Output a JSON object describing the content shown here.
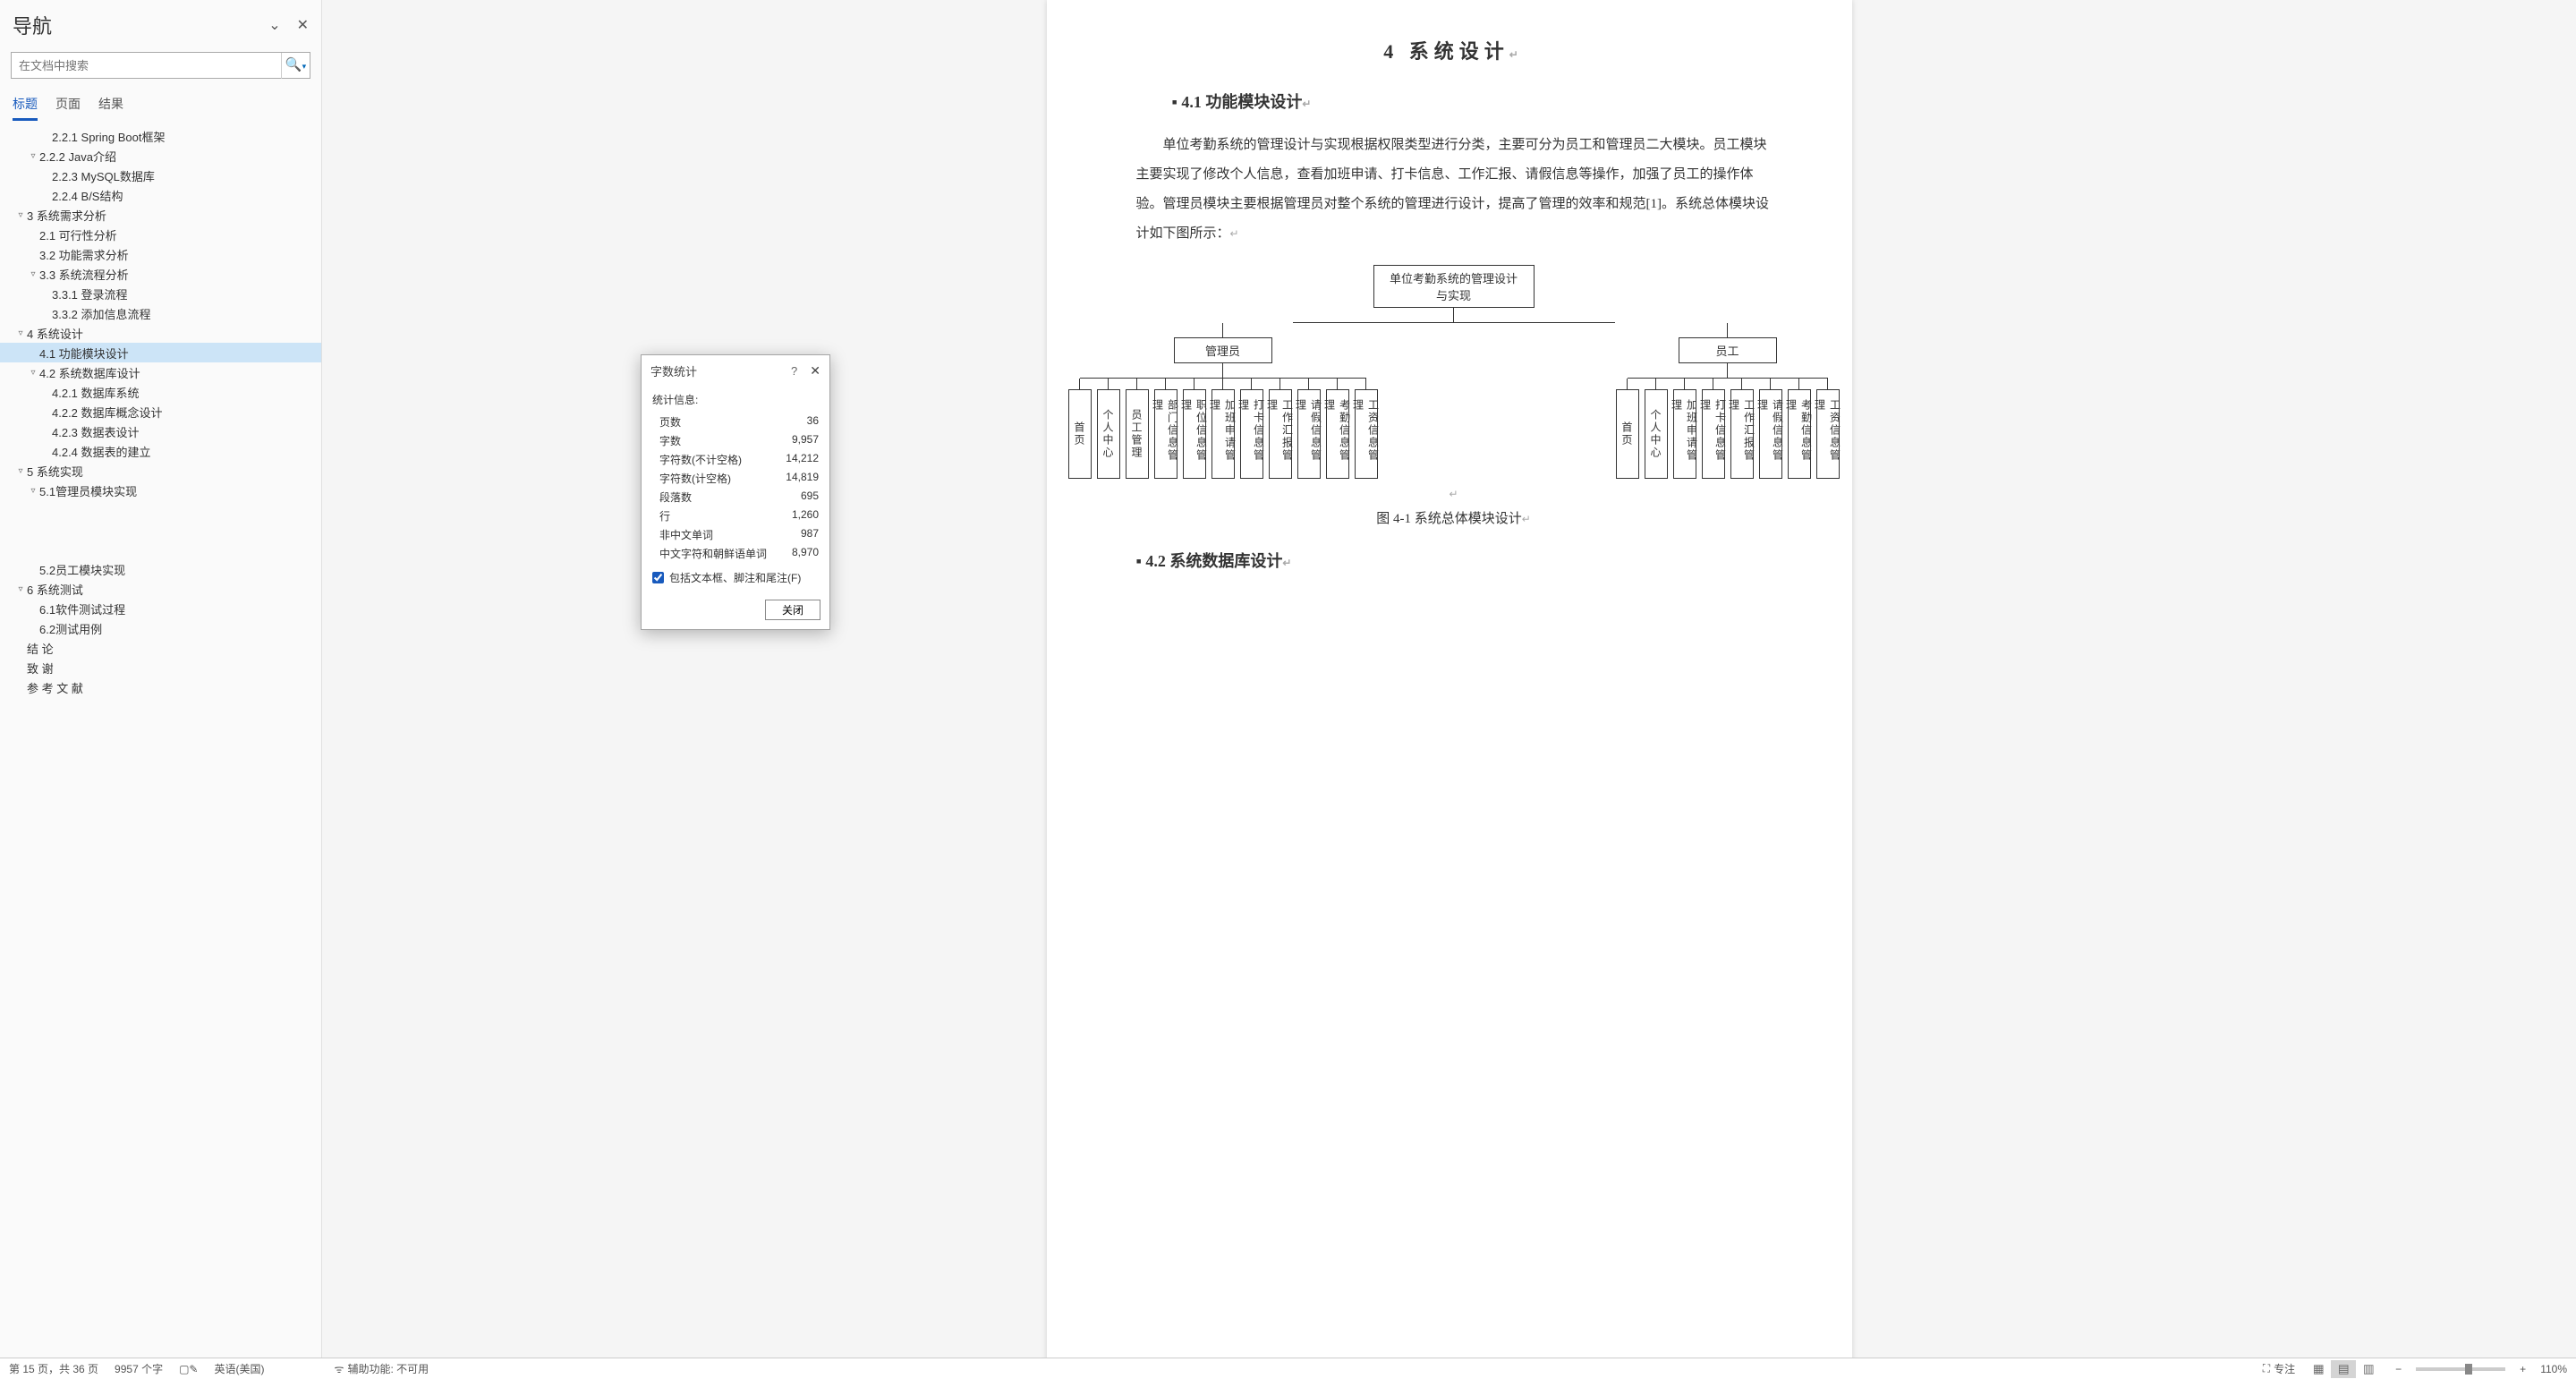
{
  "nav": {
    "title": "导航",
    "search_placeholder": "在文档中搜索",
    "tabs": [
      "标题",
      "页面",
      "结果"
    ],
    "active_tab": 0,
    "tree": [
      {
        "label": "2.2.1 Spring Boot框架",
        "level": 3,
        "expand": ""
      },
      {
        "label": "2.2.2 Java介绍",
        "level": 2,
        "expand": "▿"
      },
      {
        "label": "2.2.3 MySQL数据库",
        "level": 3,
        "expand": ""
      },
      {
        "label": "2.2.4 B/S结构",
        "level": 3,
        "expand": ""
      },
      {
        "label": "3  系统需求分析",
        "level": 1,
        "expand": "▿"
      },
      {
        "label": "2.1 可行性分析",
        "level": 2,
        "expand": ""
      },
      {
        "label": "3.2 功能需求分析",
        "level": 2,
        "expand": ""
      },
      {
        "label": "3.3 系统流程分析",
        "level": 2,
        "expand": "▿"
      },
      {
        "label": "3.3.1 登录流程",
        "level": 3,
        "expand": ""
      },
      {
        "label": "3.3.2 添加信息流程",
        "level": 3,
        "expand": ""
      },
      {
        "label": "4  系统设计",
        "level": 1,
        "expand": "▿"
      },
      {
        "label": "4.1 功能模块设计",
        "level": 2,
        "expand": "",
        "selected": true
      },
      {
        "label": "4.2 系统数据库设计",
        "level": 2,
        "expand": "▿"
      },
      {
        "label": "4.2.1 数据库系统",
        "level": 3,
        "expand": ""
      },
      {
        "label": "4.2.2 数据库概念设计",
        "level": 3,
        "expand": ""
      },
      {
        "label": "4.2.3 数据表设计",
        "level": 3,
        "expand": ""
      },
      {
        "label": "4.2.4 数据表的建立",
        "level": 3,
        "expand": ""
      },
      {
        "label": "5  系统实现",
        "level": 1,
        "expand": "▿"
      },
      {
        "label": "5.1管理员模块实现",
        "level": 2,
        "expand": "▿"
      },
      {
        "label": "",
        "level": 3,
        "expand": "",
        "spacer": true
      },
      {
        "label": "",
        "level": 3,
        "expand": "",
        "spacer": true
      },
      {
        "label": "",
        "level": 3,
        "expand": "",
        "spacer": true
      },
      {
        "label": "5.2员工模块实现",
        "level": 2,
        "expand": ""
      },
      {
        "label": "6  系统测试",
        "level": 1,
        "expand": "▿"
      },
      {
        "label": "6.1软件测试过程",
        "level": 2,
        "expand": ""
      },
      {
        "label": "6.2测试用例",
        "level": 2,
        "expand": ""
      },
      {
        "label": "结  论",
        "level": 1,
        "expand": ""
      },
      {
        "label": "致  谢",
        "level": 1,
        "expand": ""
      },
      {
        "label": "参 考 文 献",
        "level": 1,
        "expand": ""
      }
    ]
  },
  "doc": {
    "h1": "4  系统设计",
    "h2_1": "4.1 功能模块设计",
    "body1": "单位考勤系统的管理设计与实现根据权限类型进行分类，主要可分为员工和管理员二大模块。员工模块主要实现了修改个人信息，查看加班申请、打卡信息、工作汇报、请假信息等操作，加强了员工的操作体验。管理员模块主要根据管理员对整个系统的管理进行设计，提高了管理的效率和规范[1]。系统总体模块设计如下图所示：",
    "caption": "图 4-1  系统总体模块设计",
    "h2_2": "4.2 系统数据库设计"
  },
  "chart_data": {
    "type": "tree",
    "root": "单位考勤系统的管理设计与实现",
    "children": [
      {
        "name": "管理员",
        "children": [
          "首页",
          "个人中心",
          "员工管理",
          "部门信息管理",
          "职位信息管理",
          "加班申请管理",
          "打卡信息管理",
          "工作汇报管理",
          "请假信息管理",
          "考勤信息管理",
          "工资信息管理"
        ]
      },
      {
        "name": "员工",
        "children": [
          "首页",
          "个人中心",
          "加班申请管理",
          "打卡信息管理",
          "工作汇报管理",
          "请假信息管理",
          "考勤信息管理",
          "工资信息管理"
        ]
      }
    ]
  },
  "wordcount": {
    "title": "字数统计",
    "stats_label": "统计信息:",
    "rows": [
      {
        "k": "页数",
        "v": "36"
      },
      {
        "k": "字数",
        "v": "9,957"
      },
      {
        "k": "字符数(不计空格)",
        "v": "14,212"
      },
      {
        "k": "字符数(计空格)",
        "v": "14,819"
      },
      {
        "k": "段落数",
        "v": "695"
      },
      {
        "k": "行",
        "v": "1,260"
      },
      {
        "k": "非中文单词",
        "v": "987"
      },
      {
        "k": "中文字符和朝鲜语单词",
        "v": "8,970"
      }
    ],
    "checkbox_label": "包括文本框、脚注和尾注(F)",
    "close_btn": "关闭"
  },
  "status": {
    "page": "第 15 页，共 36 页",
    "words": "9957 个字",
    "language": "英语(美国)",
    "accessibility": "辅助功能: 不可用",
    "focus": "专注",
    "zoom": "110%"
  }
}
